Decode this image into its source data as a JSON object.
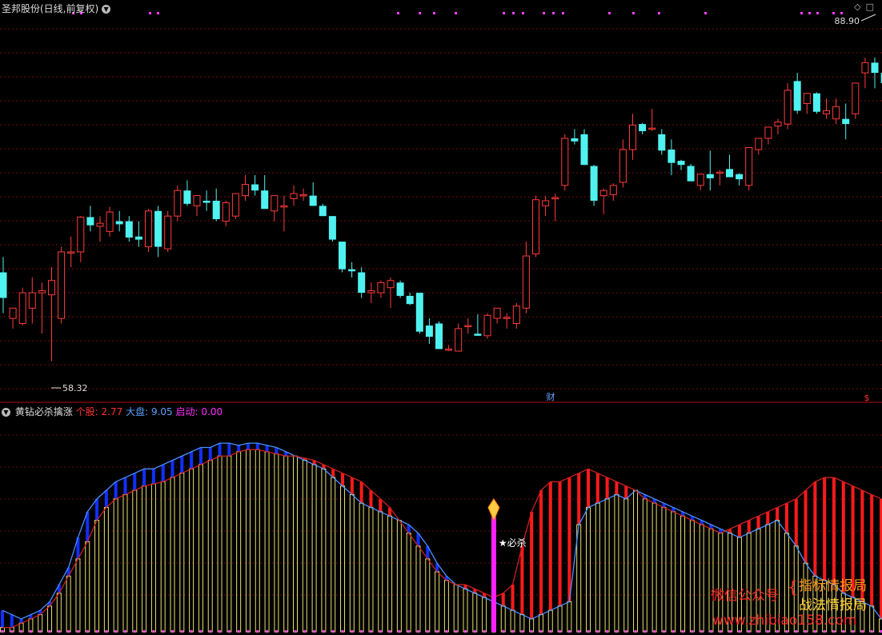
{
  "upper": {
    "title": "圣邦股份(日线,前复权)",
    "high_label": "88.90",
    "low_label": "58.32",
    "cai_marker": "财",
    "dollar_marker": "$",
    "ylim": [
      55,
      93
    ]
  },
  "lower": {
    "indicator_name": "黄钻必杀擒涨",
    "legend": [
      {
        "label": "个股:",
        "value": "2.77",
        "color": "#ff3030"
      },
      {
        "label": "大盘:",
        "value": "9.05",
        "color": "#5aa0ff"
      },
      {
        "label": "启动:",
        "value": "0.00",
        "color": "#ff30ff"
      }
    ],
    "signal_label": "★必杀",
    "watermark_left": "微信公众号",
    "watermark_right_1": "指标情报局",
    "watermark_right_2": "战法情报局",
    "watermark_url": "www.zhibiao158.com"
  },
  "chart_data": [
    {
      "type": "candlestick",
      "title": "圣邦股份(日线,前复权)",
      "ylim": [
        55,
        93
      ],
      "candles": [
        {
          "o": 67,
          "h": 68.5,
          "l": 63,
          "c": 64.5
        },
        {
          "o": 62.5,
          "h": 63.5,
          "l": 61.5,
          "c": 63.5
        },
        {
          "o": 62,
          "h": 65.5,
          "l": 61.8,
          "c": 65
        },
        {
          "o": 63.5,
          "h": 66.5,
          "l": 62,
          "c": 65
        },
        {
          "o": 65,
          "h": 66,
          "l": 61,
          "c": 65.2
        },
        {
          "o": 64.8,
          "h": 67.5,
          "l": 58.3,
          "c": 66.2
        },
        {
          "o": 62.5,
          "h": 69.5,
          "l": 62,
          "c": 69
        },
        {
          "o": 69,
          "h": 70.5,
          "l": 67.5,
          "c": 69
        },
        {
          "o": 69,
          "h": 72.5,
          "l": 68,
          "c": 72.4
        },
        {
          "o": 72.4,
          "h": 73.5,
          "l": 71,
          "c": 71.6
        },
        {
          "o": 71.5,
          "h": 72.5,
          "l": 70,
          "c": 71.8
        },
        {
          "o": 71,
          "h": 73.4,
          "l": 70.5,
          "c": 72.9
        },
        {
          "o": 72,
          "h": 73,
          "l": 71,
          "c": 71.7
        },
        {
          "o": 72,
          "h": 72.5,
          "l": 70,
          "c": 70.4
        },
        {
          "o": 70.5,
          "h": 72,
          "l": 69.5,
          "c": 70.2
        },
        {
          "o": 69.5,
          "h": 73.2,
          "l": 69,
          "c": 73
        },
        {
          "o": 73,
          "h": 73.5,
          "l": 68.5,
          "c": 69.5
        },
        {
          "o": 69.3,
          "h": 73,
          "l": 69,
          "c": 72.5
        },
        {
          "o": 72.5,
          "h": 75.5,
          "l": 72,
          "c": 75
        },
        {
          "o": 75,
          "h": 76,
          "l": 73.5,
          "c": 73.7
        },
        {
          "o": 73.5,
          "h": 74.5,
          "l": 72.5,
          "c": 74.5
        },
        {
          "o": 74,
          "h": 75,
          "l": 73,
          "c": 73.8
        },
        {
          "o": 74,
          "h": 75.2,
          "l": 72,
          "c": 72.2
        },
        {
          "o": 72,
          "h": 74,
          "l": 71.5,
          "c": 73.8
        },
        {
          "o": 72.5,
          "h": 74.5,
          "l": 72.2,
          "c": 74.7
        },
        {
          "o": 74.5,
          "h": 76.5,
          "l": 74,
          "c": 75.6
        },
        {
          "o": 75.6,
          "h": 76.5,
          "l": 74.5,
          "c": 75
        },
        {
          "o": 75,
          "h": 76.5,
          "l": 73.5,
          "c": 73.2
        },
        {
          "o": 73,
          "h": 73.2,
          "l": 72,
          "c": 74.5
        },
        {
          "o": 73.5,
          "h": 74.5,
          "l": 71,
          "c": 73.5
        },
        {
          "o": 74.2,
          "h": 75.5,
          "l": 73.5,
          "c": 74.7
        },
        {
          "o": 74.5,
          "h": 75.2,
          "l": 74,
          "c": 74.6
        },
        {
          "o": 74.5,
          "h": 75.8,
          "l": 73.5,
          "c": 73.5
        },
        {
          "o": 73.5,
          "h": 73.7,
          "l": 72.5,
          "c": 72.5
        },
        {
          "o": 72.5,
          "h": 72.5,
          "l": 70,
          "c": 70.2
        },
        {
          "o": 70,
          "h": 70,
          "l": 67,
          "c": 67.3
        },
        {
          "o": 67.3,
          "h": 68,
          "l": 66.5,
          "c": 67.1
        },
        {
          "o": 67,
          "h": 67.5,
          "l": 64.5,
          "c": 65
        },
        {
          "o": 65,
          "h": 66,
          "l": 64,
          "c": 65.2
        },
        {
          "o": 65,
          "h": 66.2,
          "l": 64.5,
          "c": 66
        },
        {
          "o": 65.5,
          "h": 66.5,
          "l": 63.5,
          "c": 66.2
        },
        {
          "o": 66,
          "h": 66.2,
          "l": 64.5,
          "c": 64.7
        },
        {
          "o": 64.7,
          "h": 65,
          "l": 63.8,
          "c": 63.9
        },
        {
          "o": 65,
          "h": 65,
          "l": 61,
          "c": 61.2
        },
        {
          "o": 61.8,
          "h": 62.5,
          "l": 60,
          "c": 60.7
        },
        {
          "o": 62,
          "h": 62.2,
          "l": 59.5,
          "c": 59.5
        },
        {
          "o": 59.5,
          "h": 59.9,
          "l": 59.3,
          "c": 59.5
        },
        {
          "o": 59.3,
          "h": 62,
          "l": 59.3,
          "c": 61.5
        },
        {
          "o": 61.8,
          "h": 62.5,
          "l": 61,
          "c": 61.8
        },
        {
          "o": 61,
          "h": 62.9,
          "l": 60.8,
          "c": 60.8
        },
        {
          "o": 60.8,
          "h": 63,
          "l": 60.5,
          "c": 62.8
        },
        {
          "o": 62.5,
          "h": 63.5,
          "l": 62,
          "c": 63.5
        },
        {
          "o": 62.5,
          "h": 63,
          "l": 61.5,
          "c": 62.6
        },
        {
          "o": 62,
          "h": 64,
          "l": 61.5,
          "c": 63.7
        },
        {
          "o": 63.5,
          "h": 70,
          "l": 63,
          "c": 68.6
        },
        {
          "o": 68.8,
          "h": 74.5,
          "l": 68.5,
          "c": 74.1
        },
        {
          "o": 73.5,
          "h": 74.5,
          "l": 72.5,
          "c": 74
        },
        {
          "o": 74.3,
          "h": 74.7,
          "l": 72,
          "c": 74.3
        },
        {
          "o": 75.5,
          "h": 80.5,
          "l": 75,
          "c": 80.1
        },
        {
          "o": 80.1,
          "h": 81,
          "l": 79.5,
          "c": 79.8
        },
        {
          "o": 80.5,
          "h": 81,
          "l": 77.5,
          "c": 77.5
        },
        {
          "o": 77.4,
          "h": 77.5,
          "l": 73.5,
          "c": 74
        },
        {
          "o": 74.5,
          "h": 75.2,
          "l": 72.7,
          "c": 75
        },
        {
          "o": 74.6,
          "h": 75.7,
          "l": 74,
          "c": 75.5
        },
        {
          "o": 75.8,
          "h": 80,
          "l": 75.3,
          "c": 79
        },
        {
          "o": 79,
          "h": 82.5,
          "l": 78,
          "c": 81.4
        },
        {
          "o": 81.5,
          "h": 81.6,
          "l": 80.5,
          "c": 80.8
        },
        {
          "o": 81,
          "h": 83,
          "l": 80.8,
          "c": 81.1
        },
        {
          "o": 80.5,
          "h": 81,
          "l": 78.5,
          "c": 78.9
        },
        {
          "o": 79,
          "h": 80,
          "l": 76.5,
          "c": 77.7
        },
        {
          "o": 77.9,
          "h": 78,
          "l": 77,
          "c": 77.5
        },
        {
          "o": 77.4,
          "h": 77.6,
          "l": 76,
          "c": 75.9
        },
        {
          "o": 75.5,
          "h": 76.5,
          "l": 75,
          "c": 76.6
        },
        {
          "o": 76.6,
          "h": 78.9,
          "l": 75,
          "c": 76.2
        },
        {
          "o": 76.7,
          "h": 77,
          "l": 75.5,
          "c": 76.8
        },
        {
          "o": 77.1,
          "h": 78.5,
          "l": 76.5,
          "c": 76.3
        },
        {
          "o": 76.6,
          "h": 76.7,
          "l": 75.5,
          "c": 76.1
        },
        {
          "o": 75.5,
          "h": 77,
          "l": 75,
          "c": 79.2
        },
        {
          "o": 79,
          "h": 80,
          "l": 78.5,
          "c": 80.1
        },
        {
          "o": 80.1,
          "h": 81.2,
          "l": 79.5,
          "c": 81.2
        },
        {
          "o": 81.3,
          "h": 82,
          "l": 80.5,
          "c": 81.7
        },
        {
          "o": 81.5,
          "h": 85.5,
          "l": 81,
          "c": 84.8
        },
        {
          "o": 85.7,
          "h": 86.5,
          "l": 82.5,
          "c": 82.8
        },
        {
          "o": 83.5,
          "h": 84.5,
          "l": 82.5,
          "c": 84.5
        },
        {
          "o": 84.5,
          "h": 84.6,
          "l": 82.5,
          "c": 82.7
        },
        {
          "o": 82.5,
          "h": 84,
          "l": 82,
          "c": 82.8
        },
        {
          "o": 82,
          "h": 84,
          "l": 81.5,
          "c": 83.2
        },
        {
          "o": 82,
          "h": 83.5,
          "l": 80,
          "c": 81.5
        },
        {
          "o": 82.5,
          "h": 84.5,
          "l": 82,
          "c": 85.5
        },
        {
          "o": 86.5,
          "h": 88,
          "l": 85,
          "c": 87.5
        },
        {
          "o": 87.5,
          "h": 88,
          "l": 85,
          "c": 86.5
        },
        {
          "o": 86.5,
          "h": 87,
          "l": 84.5,
          "c": 85.5
        },
        {
          "o": 86,
          "h": 90.5,
          "l": 85,
          "c": 90.5
        }
      ],
      "annotations": [
        "88.90",
        "58.32",
        "财",
        "$"
      ]
    },
    {
      "type": "bar",
      "title": "黄钻必杀擒涨",
      "ylim": [
        0,
        100
      ],
      "series": [
        {
          "name": "个股",
          "values": [
            2,
            2,
            4,
            6,
            8,
            12,
            18,
            26,
            34,
            42,
            52,
            58,
            62,
            64,
            66,
            68,
            69,
            70,
            72,
            74,
            76,
            78,
            80,
            82,
            82,
            84,
            85,
            85,
            84,
            83,
            82,
            82,
            81,
            80,
            78,
            76,
            74,
            72,
            70,
            66,
            62,
            58,
            52,
            46,
            40,
            34,
            28,
            24,
            22,
            22,
            20,
            18,
            16,
            18,
            22,
            40,
            56,
            66,
            70,
            70,
            72,
            74,
            76,
            74,
            72,
            70,
            68,
            66,
            62,
            60,
            58,
            56,
            54,
            52,
            50,
            48,
            46,
            48,
            50,
            52,
            54,
            56,
            58,
            60,
            62,
            66,
            70,
            72,
            72,
            70,
            68,
            66,
            64,
            62
          ]
        },
        {
          "name": "大盘",
          "values": [
            10,
            8,
            6,
            8,
            10,
            14,
            22,
            30,
            44,
            56,
            62,
            66,
            70,
            72,
            74,
            76,
            76,
            78,
            80,
            82,
            84,
            86,
            86,
            88,
            88,
            87,
            88,
            88,
            87,
            86,
            84,
            82,
            80,
            78,
            76,
            72,
            68,
            64,
            60,
            58,
            56,
            54,
            52,
            50,
            46,
            40,
            32,
            26,
            22,
            20,
            18,
            16,
            14,
            12,
            10,
            8,
            6,
            8,
            10,
            12,
            14,
            50,
            58,
            60,
            62,
            64,
            62,
            66,
            64,
            62,
            60,
            58,
            56,
            54,
            52,
            50,
            48,
            46,
            44,
            46,
            48,
            50,
            52,
            46,
            40,
            32,
            26,
            24,
            22,
            18,
            16,
            14,
            12,
            6
          ]
        },
        {
          "name": "启动",
          "values": [
            0,
            0,
            0,
            0,
            0,
            0,
            0,
            0,
            0,
            0,
            0,
            0,
            0,
            0,
            0,
            0,
            0,
            0,
            0,
            0,
            0,
            0,
            0,
            0,
            0,
            0,
            0,
            0,
            0,
            0,
            0,
            0,
            0,
            0,
            0,
            0,
            0,
            0,
            0,
            0,
            0,
            0,
            0,
            0,
            0,
            0,
            0,
            0,
            0,
            0,
            0,
            0,
            0,
            0,
            0,
            0,
            0,
            0,
            0,
            0,
            0,
            0,
            0,
            0,
            0,
            0,
            0,
            0,
            0,
            0,
            0,
            0,
            0,
            0,
            0,
            0,
            0,
            0,
            0,
            0,
            0,
            0,
            0,
            0,
            0,
            0,
            0,
            0,
            0,
            0,
            0,
            0,
            0,
            0
          ]
        }
      ],
      "legend_values": {
        "个股": "2.77",
        "大盘": "9.05",
        "启动": "0.00"
      },
      "signal": {
        "label": "★必杀",
        "index": 52
      }
    }
  ]
}
